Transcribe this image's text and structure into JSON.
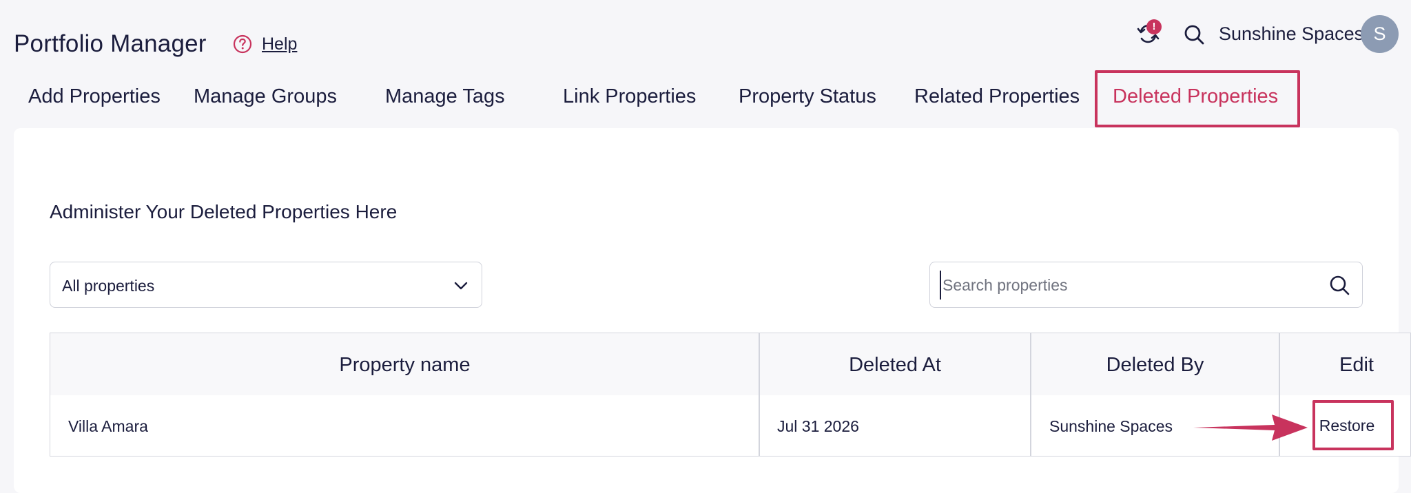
{
  "header": {
    "app_title": "Portfolio Manager",
    "help_label": "Help",
    "alert_badge": "!",
    "account_name": "Sunshine Spaces",
    "avatar_initial": "S"
  },
  "tabs": [
    {
      "label": "Add Properties",
      "active": false
    },
    {
      "label": "Manage Groups",
      "active": false
    },
    {
      "label": "Manage Tags",
      "active": false
    },
    {
      "label": "Link Properties",
      "active": false
    },
    {
      "label": "Property Status",
      "active": false
    },
    {
      "label": "Related Properties",
      "active": false
    },
    {
      "label": "Deleted Properties",
      "active": true
    }
  ],
  "main": {
    "section_title": "Administer Your Deleted Properties Here",
    "filter": {
      "selected": "All properties"
    },
    "search": {
      "placeholder": "Search properties",
      "value": ""
    },
    "table": {
      "columns": [
        "Property name",
        "Deleted At",
        "Deleted By",
        "Edit"
      ],
      "rows": [
        {
          "property_name": "Villa Amara",
          "deleted_at": "Jul 31 2026",
          "deleted_by": "Sunshine Spaces",
          "action_label": "Restore"
        }
      ]
    }
  },
  "colors": {
    "accent": "#c8335d",
    "text": "#1b1d3d",
    "background": "#f6f6f9",
    "avatar": "#8c9bb3"
  },
  "icons": {
    "help": "question-circle-icon",
    "sync": "sync-icon",
    "search": "search-icon",
    "chevron": "chevron-down-icon"
  }
}
